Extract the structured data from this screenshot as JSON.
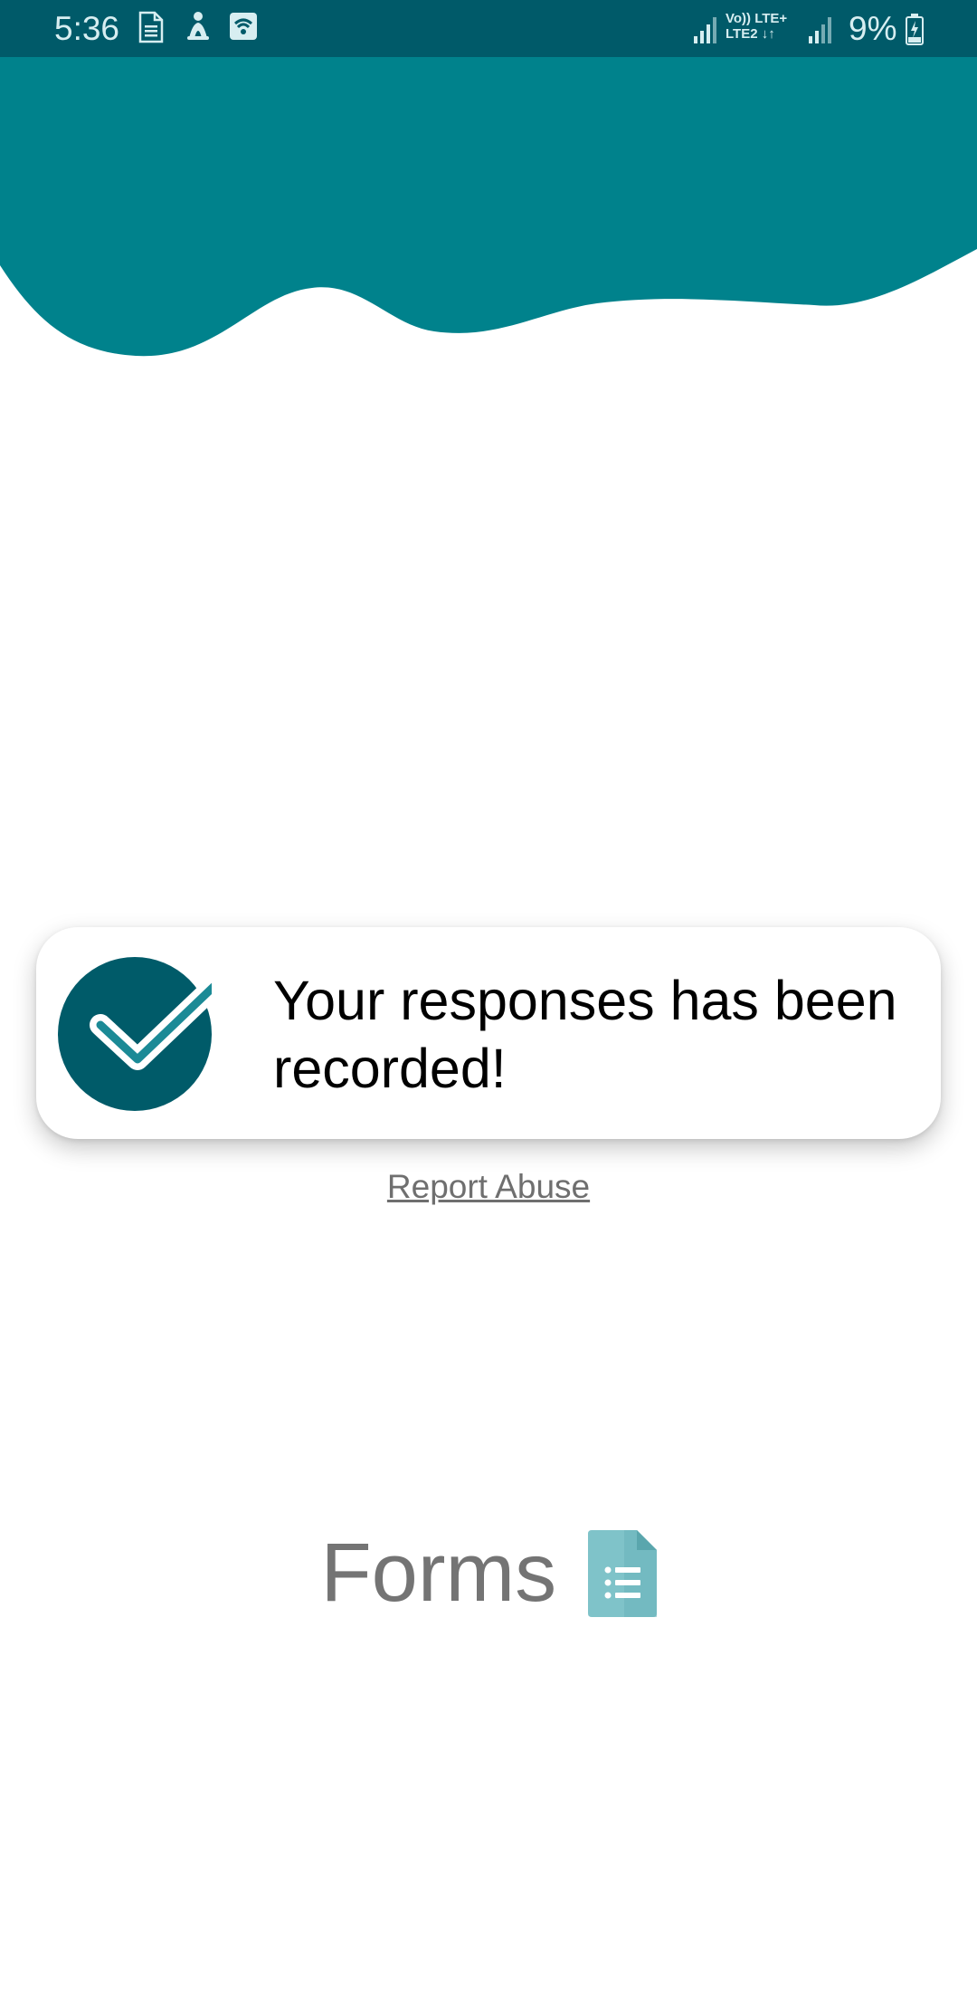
{
  "status_bar": {
    "time": "5:36",
    "network_label_top": "Vo)) LTE+",
    "network_label_bottom": "LTE2 ↓↑",
    "battery_percent": "9%",
    "icons": [
      "document-icon",
      "accessibility-icon",
      "wifi-calling-icon",
      "signal-icon",
      "signal-icon-2",
      "battery-charging-icon"
    ]
  },
  "confirmation": {
    "message": "Your responses has been recorded!",
    "icon": "check-circle-icon"
  },
  "report_abuse": {
    "label": "Report Abuse"
  },
  "branding": {
    "wordmark": "Forms",
    "icon": "forms-document-icon"
  },
  "colors": {
    "header_teal": "#00828c",
    "status_bar": "#005a69",
    "check_circle": "#005b69",
    "check_accent": "#1b8a96",
    "forms_icon": "#7fc3c9"
  }
}
